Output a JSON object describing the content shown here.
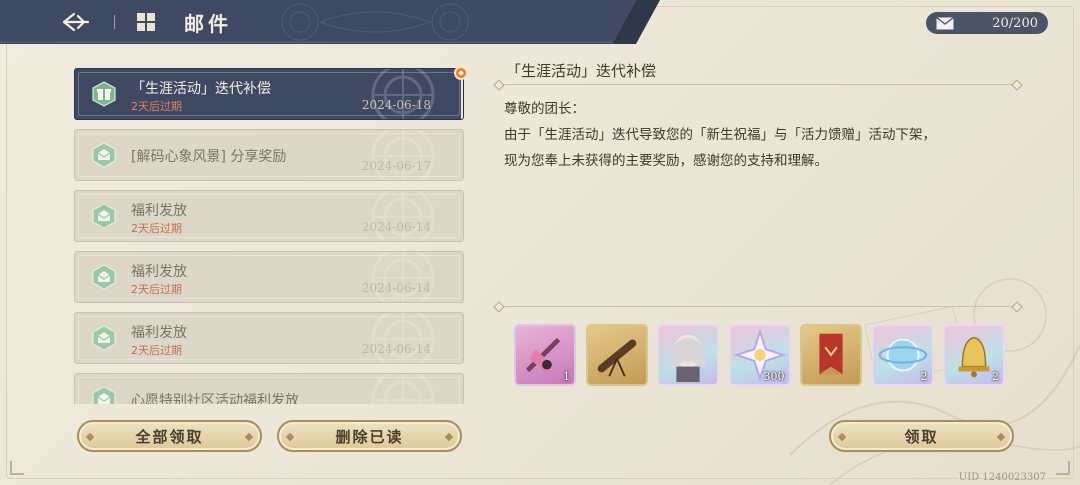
{
  "header": {
    "title": "邮件",
    "back_icon": "back-arrow-icon",
    "mail_icon": "mail-grid-icon"
  },
  "counter": {
    "value": "20/200",
    "icon": "envelope-icon"
  },
  "mail_list": [
    {
      "title": "「生涯活动」迭代补偿",
      "expiry": "2天后过期",
      "date": "2024-06-18",
      "icon": "gift-icon",
      "selected": true,
      "new": true
    },
    {
      "title": "[解码心象风景] 分享奖励",
      "expiry": "",
      "date": "2024-06-17",
      "icon": "open-mail-icon",
      "selected": false
    },
    {
      "title": "福利发放",
      "expiry": "2天后过期",
      "date": "2024-06-14",
      "icon": "open-mail-icon",
      "selected": false
    },
    {
      "title": "福利发放",
      "expiry": "2天后过期",
      "date": "2024-06-14",
      "icon": "open-mail-icon",
      "selected": false
    },
    {
      "title": "福利发放",
      "expiry": "2天后过期",
      "date": "2024-06-14",
      "icon": "open-mail-icon",
      "selected": false
    },
    {
      "title": "心愿特别社区活动福利发放",
      "expiry": "",
      "date": "",
      "icon": "open-mail-icon",
      "selected": false
    }
  ],
  "buttons": {
    "claim_all": "全部领取",
    "delete_read": "删除已读",
    "claim": "领取"
  },
  "detail": {
    "title": "「生涯活动」迭代补偿",
    "greeting": "尊敬的团长：",
    "body_line1": "由于「生涯活动」迭代导致您的「新生祝福」与「活力馈赠」活动下架，",
    "body_line2": "现为您奉上未获得的主要奖励，感谢您的支持和理解。"
  },
  "rewards": [
    {
      "name": "pink-tool-item",
      "qty": "1",
      "style": "rw-pink"
    },
    {
      "name": "telescope-item",
      "qty": "",
      "style": "rw-gold"
    },
    {
      "name": "character-portrait-item",
      "qty": "",
      "style": "rw-rain"
    },
    {
      "name": "star-crystal-item",
      "qty": "300",
      "style": "rw-rain"
    },
    {
      "name": "red-banner-item",
      "qty": "",
      "style": "rw-gold"
    },
    {
      "name": "blue-orb-item",
      "qty": "2",
      "style": "rw-rain"
    },
    {
      "name": "golden-bell-item",
      "qty": "2",
      "style": "rw-rain"
    }
  ],
  "footer": {
    "uid": "UID 1240023307"
  },
  "colors": {
    "header_navy": "#3f4a62",
    "accent_gold": "#a98e5c",
    "expiry_red": "#c0704f"
  }
}
